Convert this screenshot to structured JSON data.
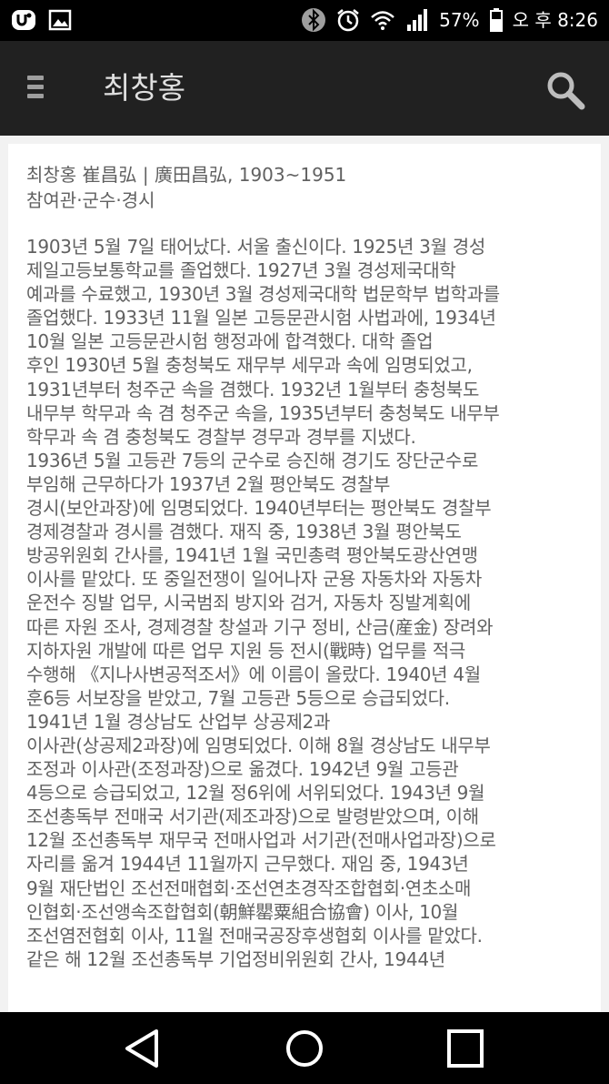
{
  "status_bar": {
    "battery": "57%",
    "time": "오 후 8:26"
  },
  "app_bar": {
    "title": "최창홍"
  },
  "entry": {
    "header_line1": "최창홍 崔昌弘 | 廣田昌弘, 1903~1951",
    "header_line2": "참여관·군수·경시",
    "body_lines": [
      "1903년 5월 7일 태어났다. 서울 출신이다. 1925년 3월 경성",
      "제일고등보통학교를 졸업했다. 1927년 3월 경성제국대학",
      "예과를 수료했고, 1930년 3월 경성제국대학 법문학부 법학과를",
      "졸업했다. 1933년 11월 일본 고등문관시험 사법과에, 1934년",
      "10월 일본 고등문관시험 행정과에 합격했다. 대학 졸업",
      "후인 1930년 5월 충청북도 재무부 세무과 속에 임명되었고,",
      "1931년부터 청주군 속을 겸했다. 1932년 1월부터 충청북도",
      "내무부 학무과 속 겸 청주군 속을, 1935년부터 충청북도 내무부",
      "학무과 속 겸 충청북도 경찰부 경무과 경부를 지냈다.",
      "1936년 5월 고등관 7등의 군수로 승진해 경기도 장단군수로",
      "부임해 근무하다가 1937년 2월 평안북도 경찰부",
      "경시(보안과장)에 임명되었다. 1940년부터는 평안북도 경찰부",
      "경제경찰과 경시를 겸했다. 재직 중, 1938년 3월 평안북도",
      "방공위원회 간사를, 1941년 1월 국민총력 평안북도광산연맹",
      "이사를 맡았다. 또 중일전쟁이 일어나자 군용 자동차와 자동차",
      "운전수 징발 업무, 시국범죄 방지와 검거, 자동차 징발계획에",
      "따른 자원 조사, 경제경찰 창설과 기구 정비, 산금(産金) 장려와",
      "지하자원 개발에 따른 업무 지원 등 전시(戰時) 업무를 적극",
      "수행해 《지나사변공적조서》에 이름이 올랐다. 1940년 4월",
      "훈6등 서보장을 받았고, 7월 고등관 5등으로 승급되었다.",
      "1941년 1월 경상남도 산업부 상공제2과",
      "이사관(상공제2과장)에 임명되었다. 이해 8월 경상남도 내무부",
      "조정과 이사관(조정과장)으로 옮겼다. 1942년 9월 고등관",
      "4등으로 승급되었고, 12월 정6위에 서위되었다. 1943년 9월",
      "조선총독부 전매국 서기관(제조과장)으로 발령받았으며, 이해",
      "12월 조선총독부 재무국 전매사업과 서기관(전매사업과장)으로",
      "자리를 옮겨 1944년 11월까지 근무했다. 재임 중, 1943년",
      "9월 재단법인 조선전매협회·조선연초경작조합협회·연초소매",
      "인협회·조선앵속조합협회(朝鮮罌粟組合協會) 이사, 10월",
      "조선염전협회 이사, 11월 전매국공장후생협회 이사를 맡았다.",
      "같은 해 12월 조선총독부 기업정비위원회 간사, 1944년"
    ]
  }
}
